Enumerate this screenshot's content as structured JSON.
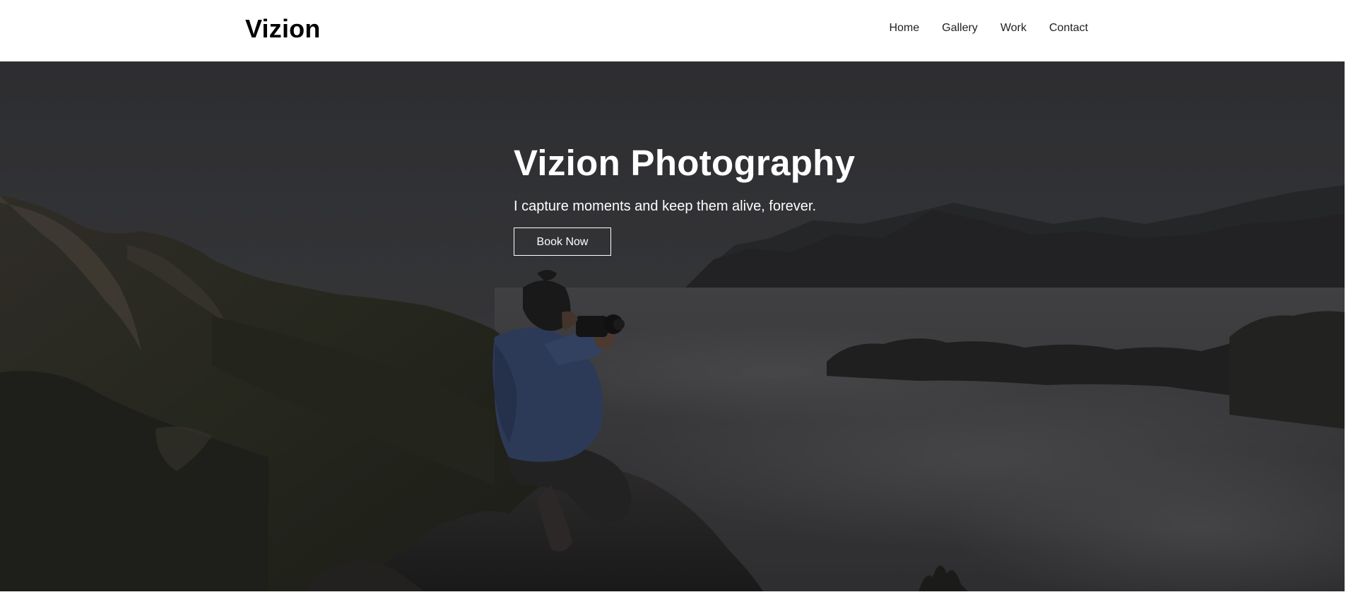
{
  "header": {
    "logo": "Vizion",
    "nav": [
      {
        "label": "Home"
      },
      {
        "label": "Gallery"
      },
      {
        "label": "Work"
      },
      {
        "label": "Contact"
      }
    ]
  },
  "hero": {
    "title": "Vizion Photography",
    "tagline": "I capture moments and keep them alive, forever.",
    "cta_label": "Book Now",
    "background_image": "photographer-on-mountain-above-clouds"
  },
  "colors": {
    "header_bg": "#ffffff",
    "logo_text": "#000000",
    "nav_text": "#222222",
    "hero_text": "#ffffff",
    "hero_overlay": "#141416"
  }
}
